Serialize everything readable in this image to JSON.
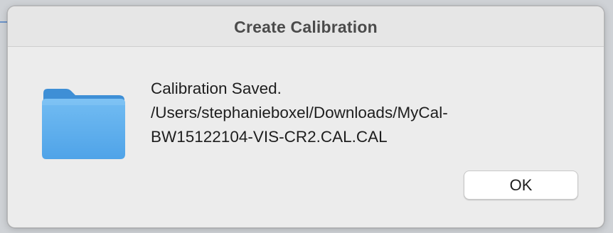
{
  "dialog": {
    "title": "Create Calibration",
    "icon": "folder-icon",
    "message_lines": [
      "Calibration Saved.",
      "/Users/stephanieboxel/Downloads/MyCal-",
      "BW15122104-VIS-CR2.CAL.CAL"
    ],
    "ok_label": "OK"
  },
  "colors": {
    "folder_front": "#5fb0ee",
    "folder_back": "#3f93d8",
    "dialog_bg": "#ececec"
  }
}
